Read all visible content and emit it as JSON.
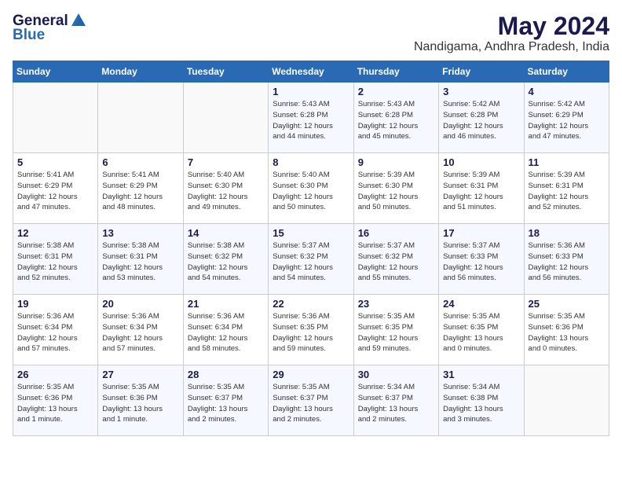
{
  "logo": {
    "general": "General",
    "blue": "Blue"
  },
  "title": {
    "month_year": "May 2024",
    "location": "Nandigama, Andhra Pradesh, India"
  },
  "days_of_week": [
    "Sunday",
    "Monday",
    "Tuesday",
    "Wednesday",
    "Thursday",
    "Friday",
    "Saturday"
  ],
  "weeks": [
    [
      {
        "num": "",
        "info": ""
      },
      {
        "num": "",
        "info": ""
      },
      {
        "num": "",
        "info": ""
      },
      {
        "num": "1",
        "info": "Sunrise: 5:43 AM\nSunset: 6:28 PM\nDaylight: 12 hours\nand 44 minutes."
      },
      {
        "num": "2",
        "info": "Sunrise: 5:43 AM\nSunset: 6:28 PM\nDaylight: 12 hours\nand 45 minutes."
      },
      {
        "num": "3",
        "info": "Sunrise: 5:42 AM\nSunset: 6:28 PM\nDaylight: 12 hours\nand 46 minutes."
      },
      {
        "num": "4",
        "info": "Sunrise: 5:42 AM\nSunset: 6:29 PM\nDaylight: 12 hours\nand 47 minutes."
      }
    ],
    [
      {
        "num": "5",
        "info": "Sunrise: 5:41 AM\nSunset: 6:29 PM\nDaylight: 12 hours\nand 47 minutes."
      },
      {
        "num": "6",
        "info": "Sunrise: 5:41 AM\nSunset: 6:29 PM\nDaylight: 12 hours\nand 48 minutes."
      },
      {
        "num": "7",
        "info": "Sunrise: 5:40 AM\nSunset: 6:30 PM\nDaylight: 12 hours\nand 49 minutes."
      },
      {
        "num": "8",
        "info": "Sunrise: 5:40 AM\nSunset: 6:30 PM\nDaylight: 12 hours\nand 50 minutes."
      },
      {
        "num": "9",
        "info": "Sunrise: 5:39 AM\nSunset: 6:30 PM\nDaylight: 12 hours\nand 50 minutes."
      },
      {
        "num": "10",
        "info": "Sunrise: 5:39 AM\nSunset: 6:31 PM\nDaylight: 12 hours\nand 51 minutes."
      },
      {
        "num": "11",
        "info": "Sunrise: 5:39 AM\nSunset: 6:31 PM\nDaylight: 12 hours\nand 52 minutes."
      }
    ],
    [
      {
        "num": "12",
        "info": "Sunrise: 5:38 AM\nSunset: 6:31 PM\nDaylight: 12 hours\nand 52 minutes."
      },
      {
        "num": "13",
        "info": "Sunrise: 5:38 AM\nSunset: 6:31 PM\nDaylight: 12 hours\nand 53 minutes."
      },
      {
        "num": "14",
        "info": "Sunrise: 5:38 AM\nSunset: 6:32 PM\nDaylight: 12 hours\nand 54 minutes."
      },
      {
        "num": "15",
        "info": "Sunrise: 5:37 AM\nSunset: 6:32 PM\nDaylight: 12 hours\nand 54 minutes."
      },
      {
        "num": "16",
        "info": "Sunrise: 5:37 AM\nSunset: 6:32 PM\nDaylight: 12 hours\nand 55 minutes."
      },
      {
        "num": "17",
        "info": "Sunrise: 5:37 AM\nSunset: 6:33 PM\nDaylight: 12 hours\nand 56 minutes."
      },
      {
        "num": "18",
        "info": "Sunrise: 5:36 AM\nSunset: 6:33 PM\nDaylight: 12 hours\nand 56 minutes."
      }
    ],
    [
      {
        "num": "19",
        "info": "Sunrise: 5:36 AM\nSunset: 6:34 PM\nDaylight: 12 hours\nand 57 minutes."
      },
      {
        "num": "20",
        "info": "Sunrise: 5:36 AM\nSunset: 6:34 PM\nDaylight: 12 hours\nand 57 minutes."
      },
      {
        "num": "21",
        "info": "Sunrise: 5:36 AM\nSunset: 6:34 PM\nDaylight: 12 hours\nand 58 minutes."
      },
      {
        "num": "22",
        "info": "Sunrise: 5:36 AM\nSunset: 6:35 PM\nDaylight: 12 hours\nand 59 minutes."
      },
      {
        "num": "23",
        "info": "Sunrise: 5:35 AM\nSunset: 6:35 PM\nDaylight: 12 hours\nand 59 minutes."
      },
      {
        "num": "24",
        "info": "Sunrise: 5:35 AM\nSunset: 6:35 PM\nDaylight: 13 hours\nand 0 minutes."
      },
      {
        "num": "25",
        "info": "Sunrise: 5:35 AM\nSunset: 6:36 PM\nDaylight: 13 hours\nand 0 minutes."
      }
    ],
    [
      {
        "num": "26",
        "info": "Sunrise: 5:35 AM\nSunset: 6:36 PM\nDaylight: 13 hours\nand 1 minute."
      },
      {
        "num": "27",
        "info": "Sunrise: 5:35 AM\nSunset: 6:36 PM\nDaylight: 13 hours\nand 1 minute."
      },
      {
        "num": "28",
        "info": "Sunrise: 5:35 AM\nSunset: 6:37 PM\nDaylight: 13 hours\nand 2 minutes."
      },
      {
        "num": "29",
        "info": "Sunrise: 5:35 AM\nSunset: 6:37 PM\nDaylight: 13 hours\nand 2 minutes."
      },
      {
        "num": "30",
        "info": "Sunrise: 5:34 AM\nSunset: 6:37 PM\nDaylight: 13 hours\nand 2 minutes."
      },
      {
        "num": "31",
        "info": "Sunrise: 5:34 AM\nSunset: 6:38 PM\nDaylight: 13 hours\nand 3 minutes."
      },
      {
        "num": "",
        "info": ""
      }
    ]
  ]
}
